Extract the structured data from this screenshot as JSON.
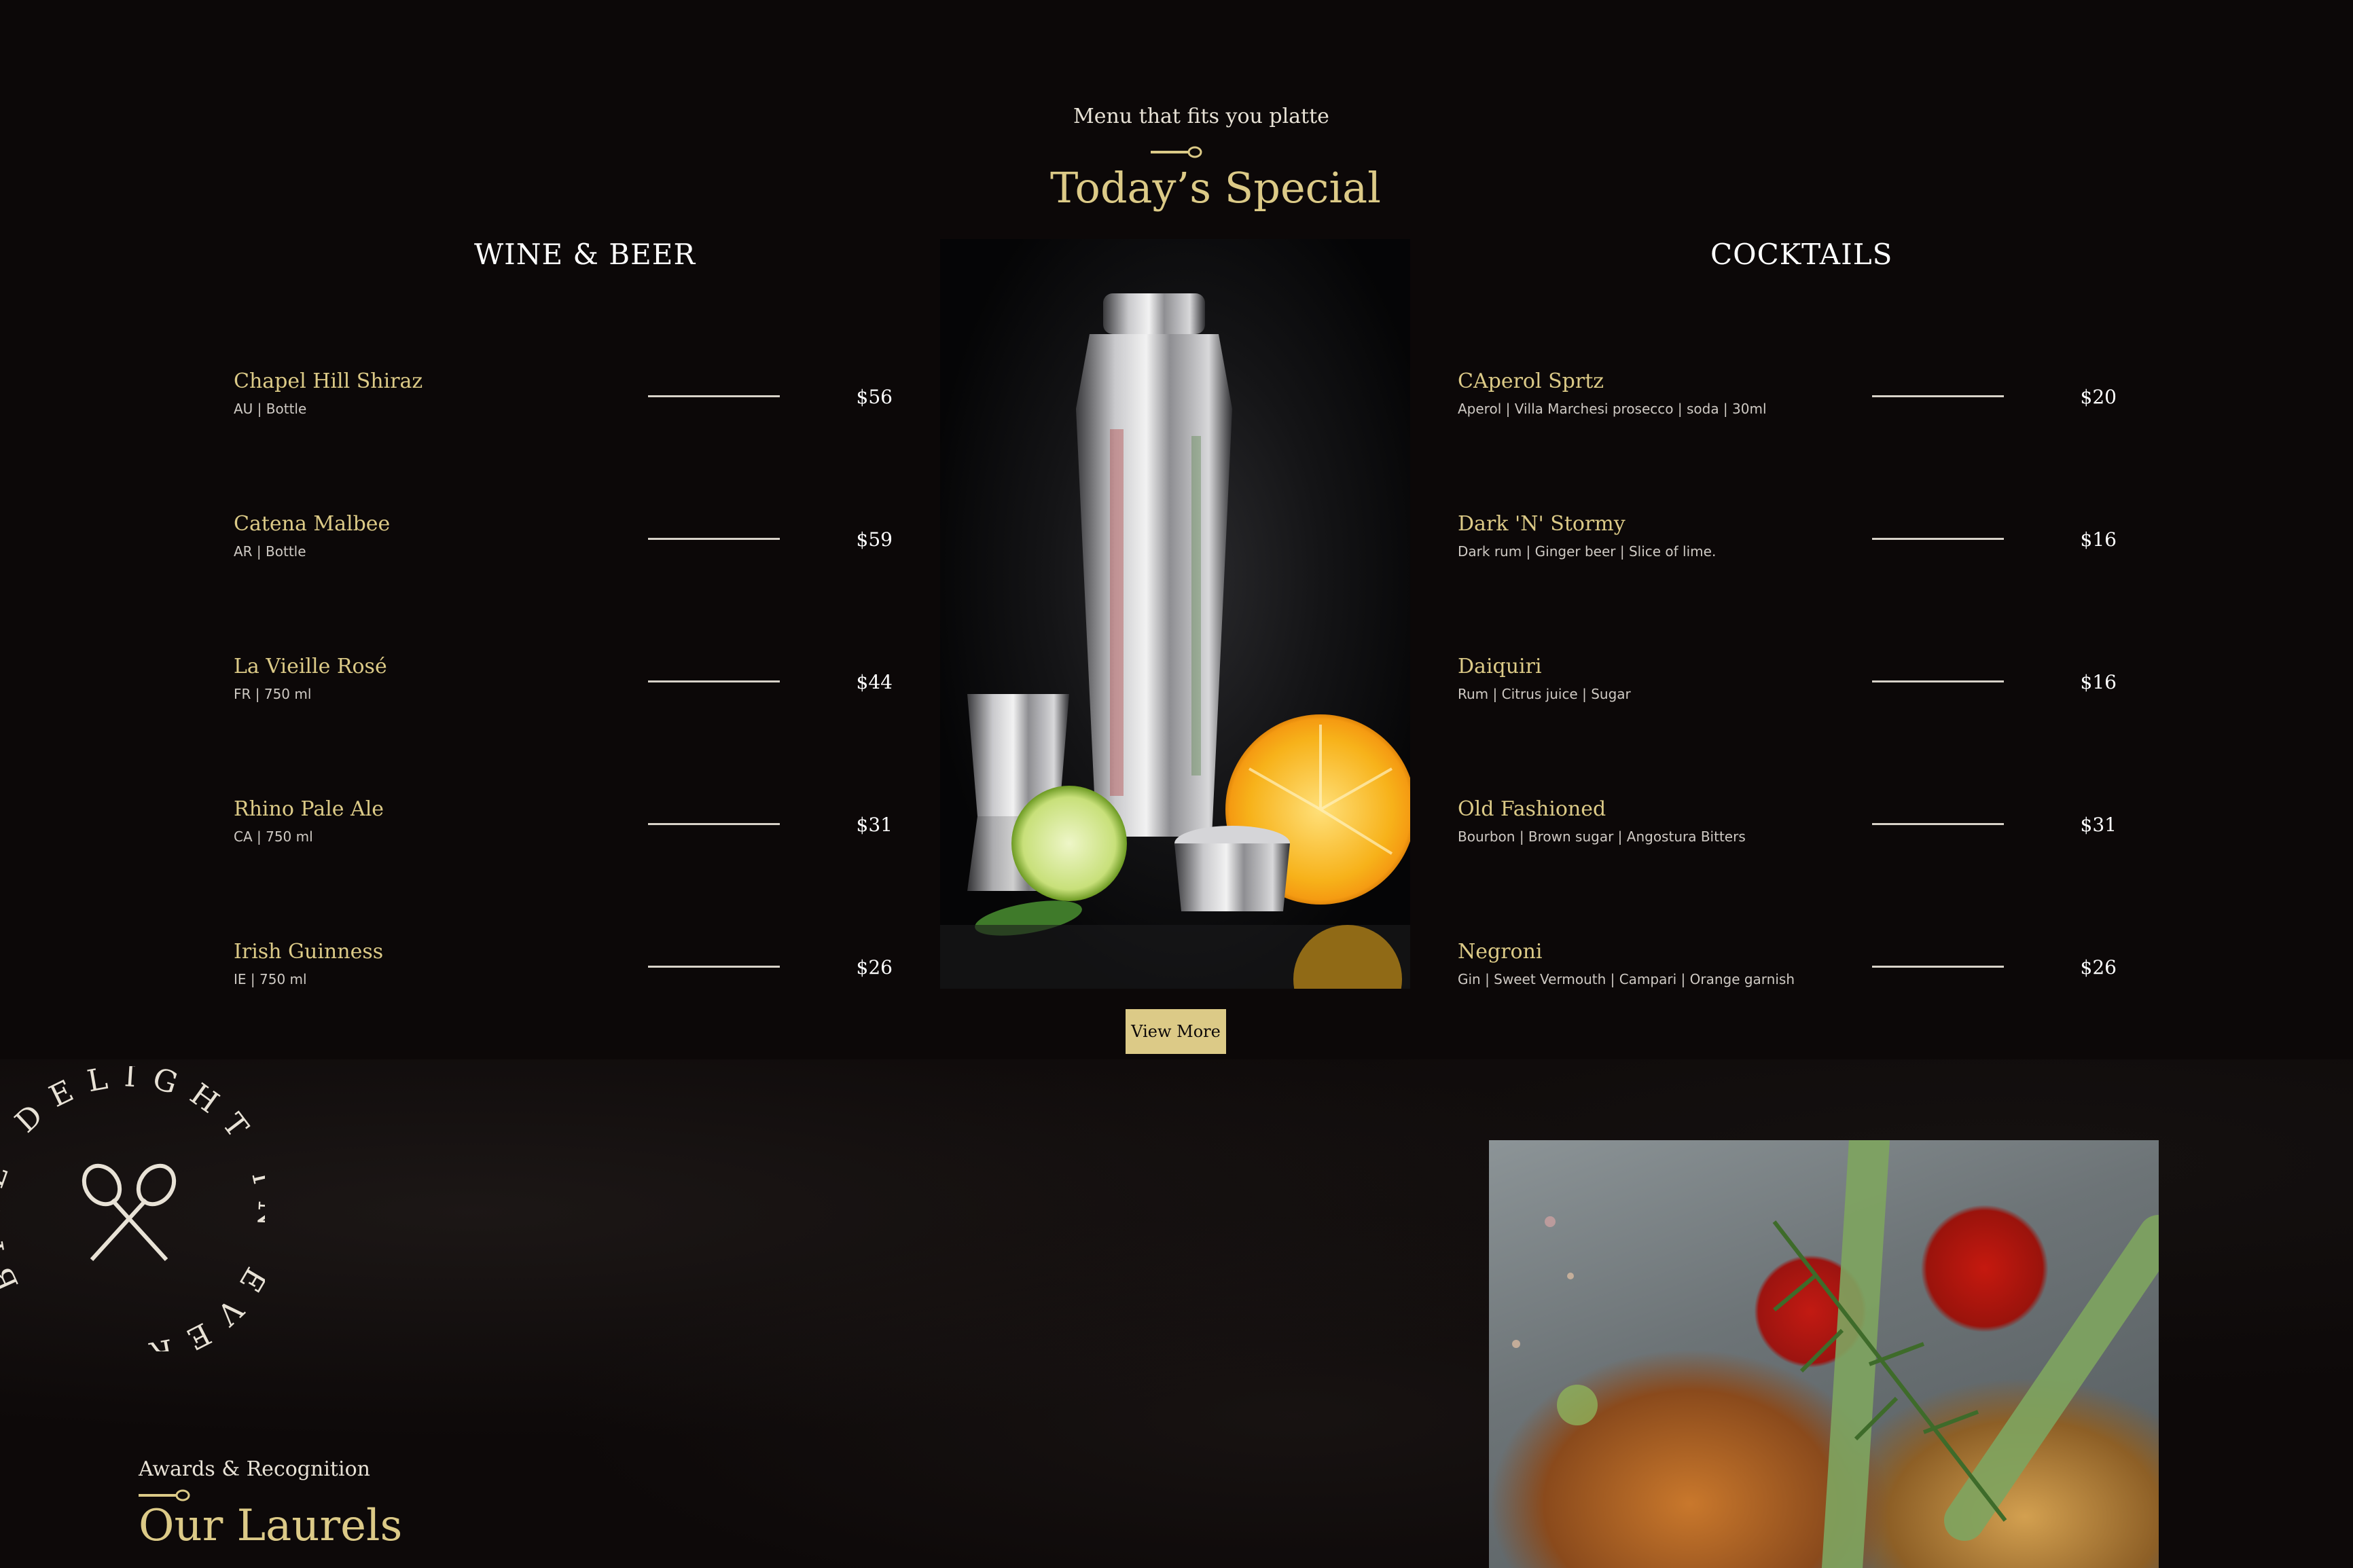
{
  "menu": {
    "subtitle": "Menu that fits you platte",
    "title": "Today’s Special",
    "wine": {
      "heading": "WINE & BEER",
      "items": [
        {
          "name": "Chapel Hill Shiraz",
          "tags": "AU | Bottle",
          "price": "$56"
        },
        {
          "name": "Catena Malbee",
          "tags": "AR | Bottle",
          "price": "$59"
        },
        {
          "name": "La Vieille Rosé",
          "tags": "FR | 750 ml",
          "price": "$44"
        },
        {
          "name": "Rhino Pale Ale",
          "tags": "CA | 750 ml",
          "price": "$31"
        },
        {
          "name": "Irish Guinness",
          "tags": "IE | 750 ml",
          "price": "$26"
        }
      ]
    },
    "cocktails": {
      "heading": "COCKTAILS",
      "items": [
        {
          "name": "CAperol Sprtz",
          "tags": "Aperol | Villa Marchesi prosecco | soda | 30ml",
          "price": "$20"
        },
        {
          "name": "Dark 'N' Stormy",
          "tags": "Dark rum | Ginger beer | Slice of lime.",
          "price": "$16"
        },
        {
          "name": "Daiquiri",
          "tags": "Rum | Citrus juice | Sugar",
          "price": "$16"
        },
        {
          "name": "Old Fashioned",
          "tags": "Bourbon | Brown sugar | Angostura Bitters",
          "price": "$31"
        },
        {
          "name": "Negroni",
          "tags": "Gin | Sweet Vermouth | Campari | Orange garnish",
          "price": "$26"
        }
      ]
    },
    "view_more": "View More"
  },
  "badge": {
    "text": "BITE DELIGHT IN EVERY",
    "icon": "crossed-spoons-icon"
  },
  "laurels": {
    "subtitle": "Awards & Recognition",
    "title": "Our Laurels"
  },
  "colors": {
    "background": "#0c0808",
    "gold": "#dcca87",
    "text": "#ffffff"
  }
}
